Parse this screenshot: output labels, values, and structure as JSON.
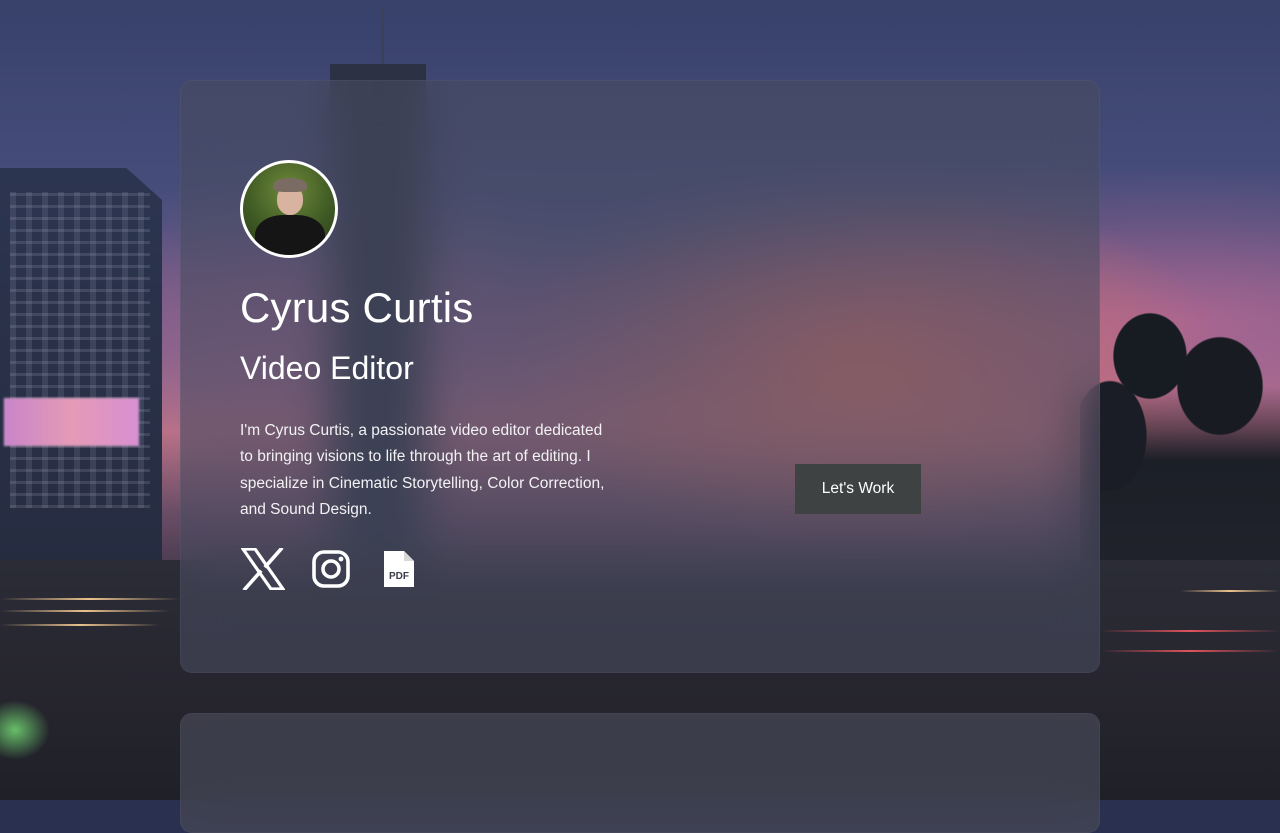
{
  "profile": {
    "name": "Cyrus Curtis",
    "title": "Video Editor",
    "bio": "I'm Cyrus Curtis, a passionate video editor dedicated to bringing visions to life through the art of editing. I specialize in Cinematic Storytelling, Color Correction, and Sound Design."
  },
  "cta": {
    "label": "Let's Work"
  },
  "socials": [
    {
      "icon": "x-logo-icon"
    },
    {
      "icon": "instagram-icon"
    },
    {
      "icon": "pdf-file-icon",
      "label": "PDF"
    }
  ],
  "colors": {
    "card": "#4a4e62",
    "button": "#3f4243",
    "text": "#ffffff"
  }
}
